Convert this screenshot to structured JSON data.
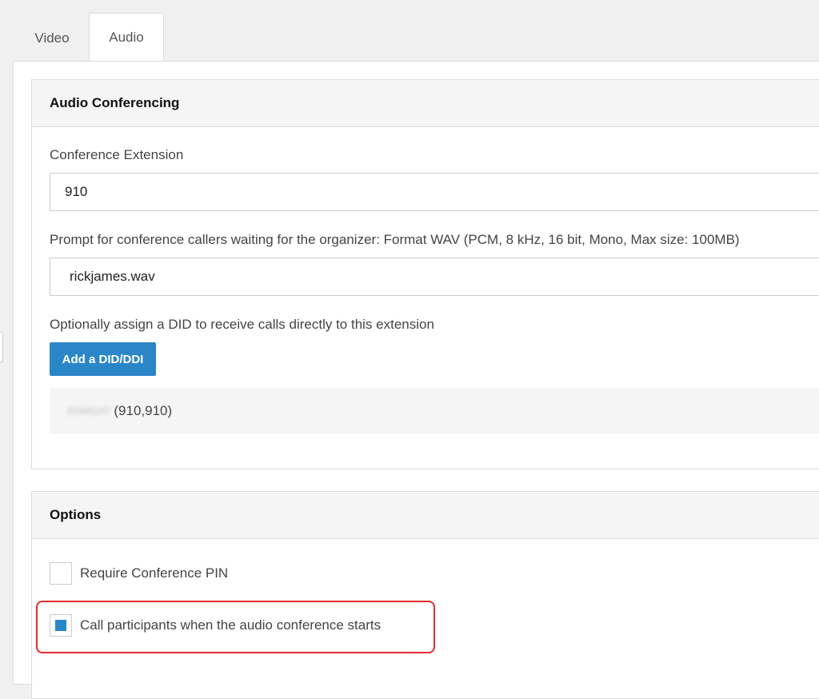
{
  "tabs": [
    {
      "label": "Video",
      "active": false
    },
    {
      "label": "Audio",
      "active": true
    }
  ],
  "audio_panel": {
    "heading": "Audio Conferencing",
    "extension_label": "Conference Extension",
    "extension_value": "910",
    "prompt_label": "Prompt for conference callers waiting for the organizer: Format WAV (PCM, 8 kHz, 16 bit, Mono, Max size: 100MB)",
    "prompt_value": "rickjames.wav",
    "did_label": "Optionally assign a DID to receive calls directly to this extension",
    "add_did_button": "Add a DID/DDI",
    "did_entry": {
      "number": "22445147",
      "suffix": "(910,910)"
    }
  },
  "options_panel": {
    "heading": "Options",
    "require_pin": {
      "label": "Require Conference PIN",
      "checked": false
    },
    "call_participants": {
      "label": "Call participants when the audio conference starts",
      "checked": true
    }
  },
  "colors": {
    "accent": "#2b86c8",
    "highlight": "#e32d2d"
  }
}
